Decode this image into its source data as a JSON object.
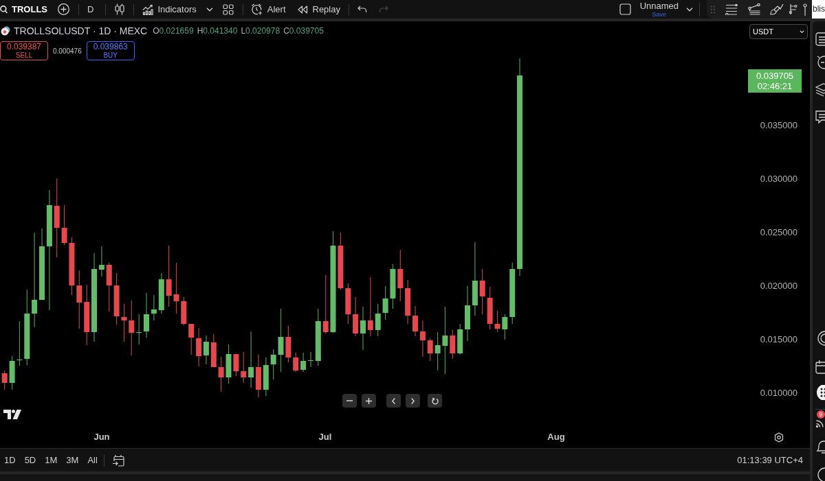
{
  "toolbar": {
    "symbol": "TROLLS",
    "interval": "D",
    "indicators": "Indicators",
    "alert": "Alert",
    "replay": "Replay",
    "layout_name": "Unnamed",
    "save": "Save"
  },
  "side_window": {
    "text": "blis"
  },
  "legend": {
    "title": "TROLLSOLUSDT · 1D · MEXC",
    "ohlc": [
      {
        "label": "O",
        "value": "0.021659"
      },
      {
        "label": "H",
        "value": "0.041340"
      },
      {
        "label": "L",
        "value": "0.020978"
      },
      {
        "label": "C",
        "value": "0.039705"
      }
    ]
  },
  "order_panel": {
    "sell": {
      "price": "0.039387",
      "label": "SELL"
    },
    "spread": "0.000476",
    "buy": {
      "price": "0.039863",
      "label": "BUY"
    }
  },
  "currency": "USDT",
  "last_price": {
    "price": "0.039705",
    "countdown": "02:46:21"
  },
  "price_axis": [
    "0.035000",
    "0.030000",
    "0.025000",
    "0.020000",
    "0.015000",
    "0.010000"
  ],
  "time_axis": [
    "Jun",
    "Jul",
    "Aug"
  ],
  "range_buttons": [
    "1D",
    "5D",
    "1M",
    "3M",
    "All"
  ],
  "clock": "01:13:39 UTC+4",
  "sidebar": {
    "badge": "9"
  }
}
